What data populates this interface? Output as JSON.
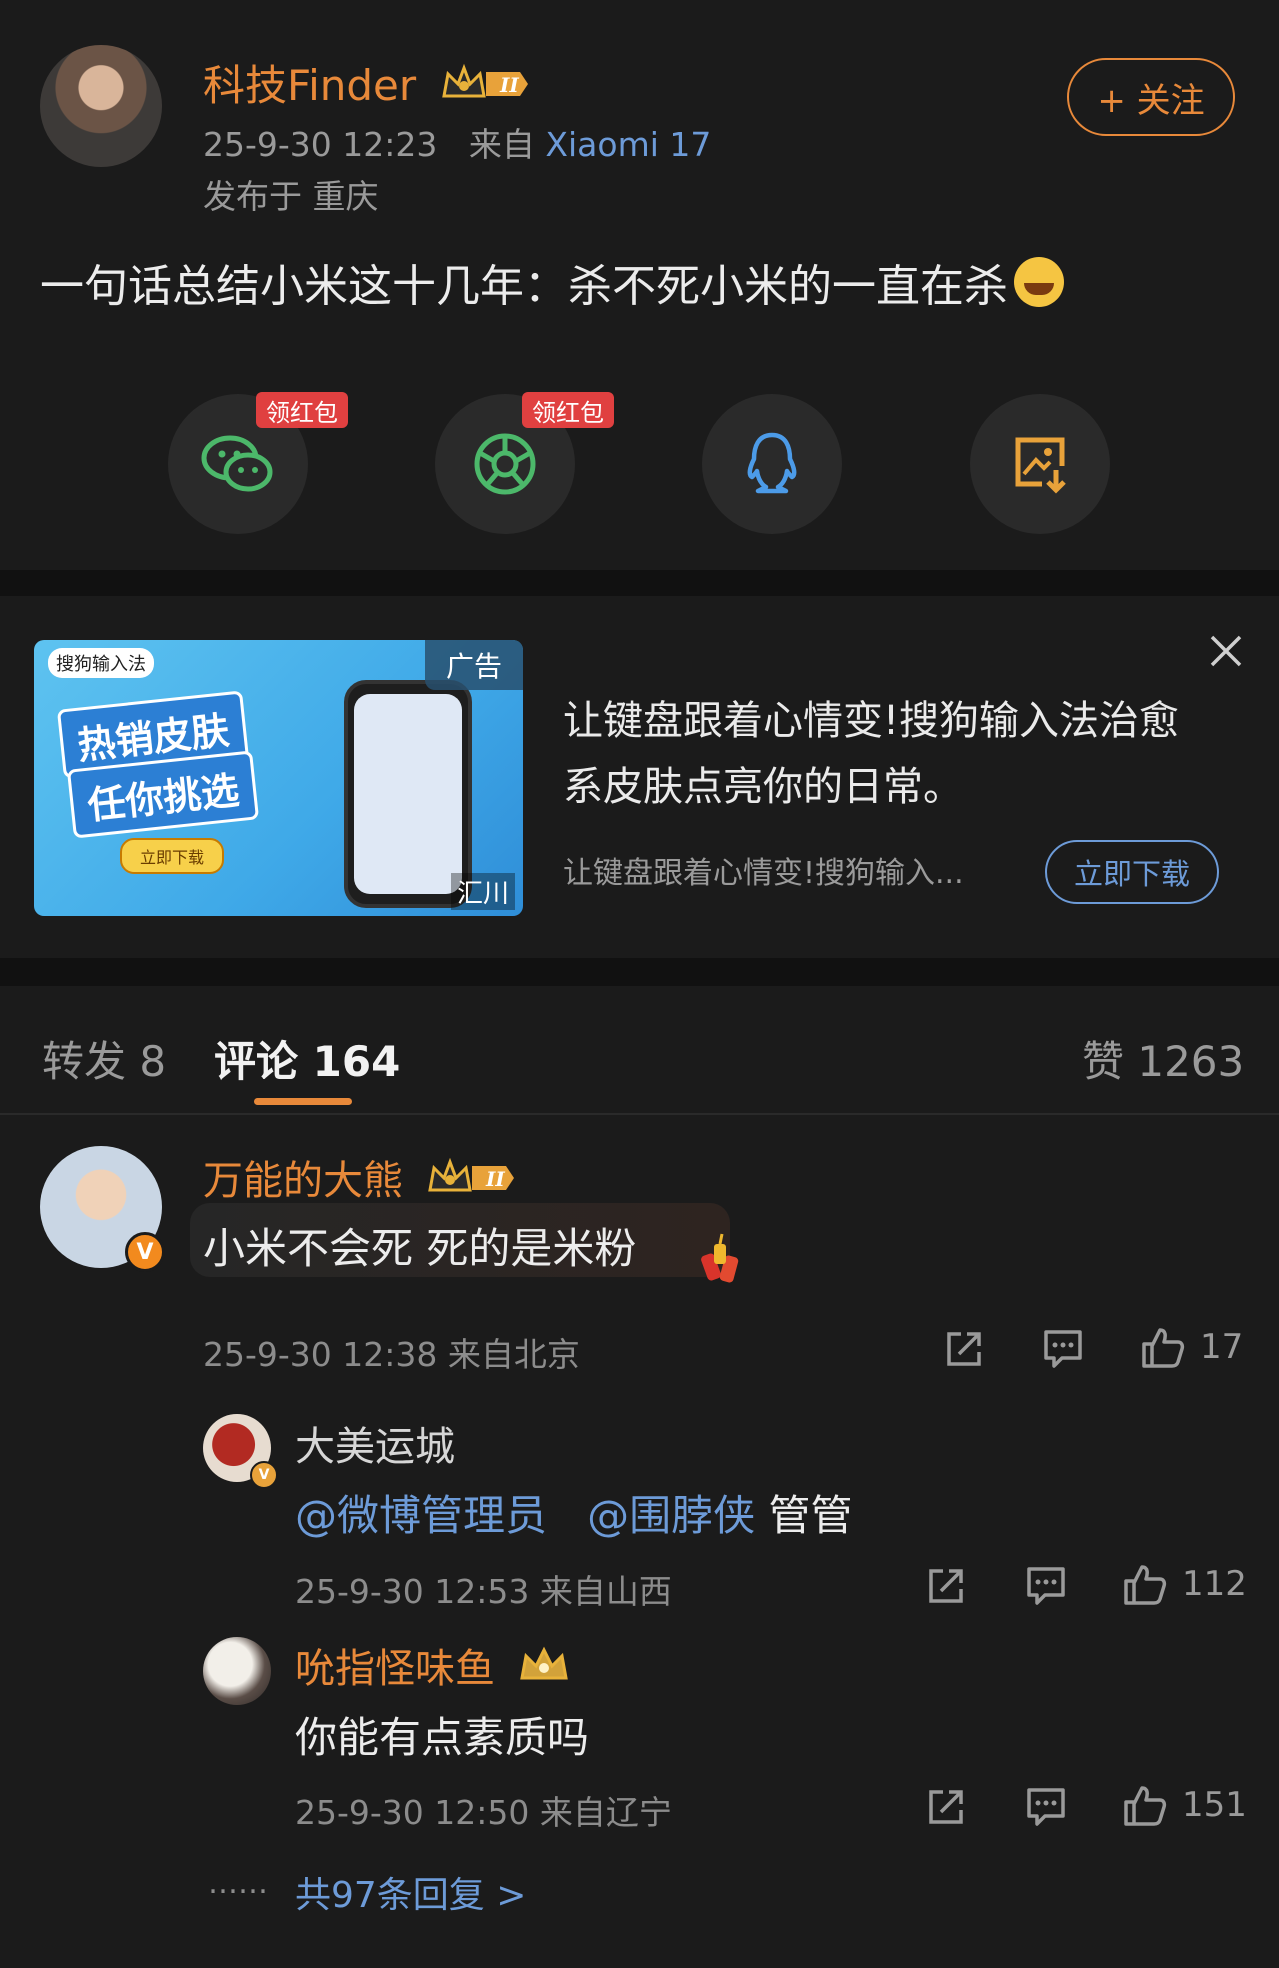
{
  "post": {
    "author": "科技Finder",
    "badge_level": "II",
    "time": "25-9-30 12:23",
    "source_prefix": "来自",
    "source_device": "Xiaomi 17",
    "location": "发布于 重庆",
    "follow_label": "+ 关注",
    "text": "一句话总结小米这十几年：杀不死小米的一直在杀"
  },
  "share": {
    "hongbao_label": "领红包",
    "items": [
      "wechat-icon",
      "moments-icon",
      "qq-icon",
      "save-image-icon"
    ]
  },
  "ad": {
    "tag": "广告",
    "logo_text": "搜狗输入法",
    "banner_line1": "热销皮肤",
    "banner_line2": "任你挑选",
    "banner_cta": "立即下载",
    "watermark": "汇川",
    "title": "让键盘跟着心情变!搜狗输入法治愈系皮肤点亮你的日常。",
    "subtitle": "让键盘跟着心情变!搜狗输入...",
    "button": "立即下载"
  },
  "tabs": {
    "repost": "转发 8",
    "comments": "评论 164",
    "likes": "赞 1263"
  },
  "comments": [
    {
      "name": "万能的大熊",
      "badge_level": "II",
      "text": "小米不会死 死的是米粉",
      "meta": "25-9-30 12:38 来自北京",
      "likes": "17",
      "replies": [
        {
          "name": "大美运城",
          "mention1": "@微博管理员",
          "mention2": "@围脖侠",
          "text": "管管",
          "meta": "25-9-30 12:53 来自山西",
          "likes": "112"
        },
        {
          "name": "吮指怪味鱼",
          "text": "你能有点素质吗",
          "meta": "25-9-30 12:50 来自辽宁",
          "likes": "151"
        }
      ],
      "more_dots": "……",
      "more_replies": "共97条回复 >"
    }
  ],
  "colors": {
    "background": "#1b1b1b",
    "accent_orange": "#e8893a",
    "link_blue": "#6d9bd8",
    "hongbao_red": "#e04040"
  }
}
